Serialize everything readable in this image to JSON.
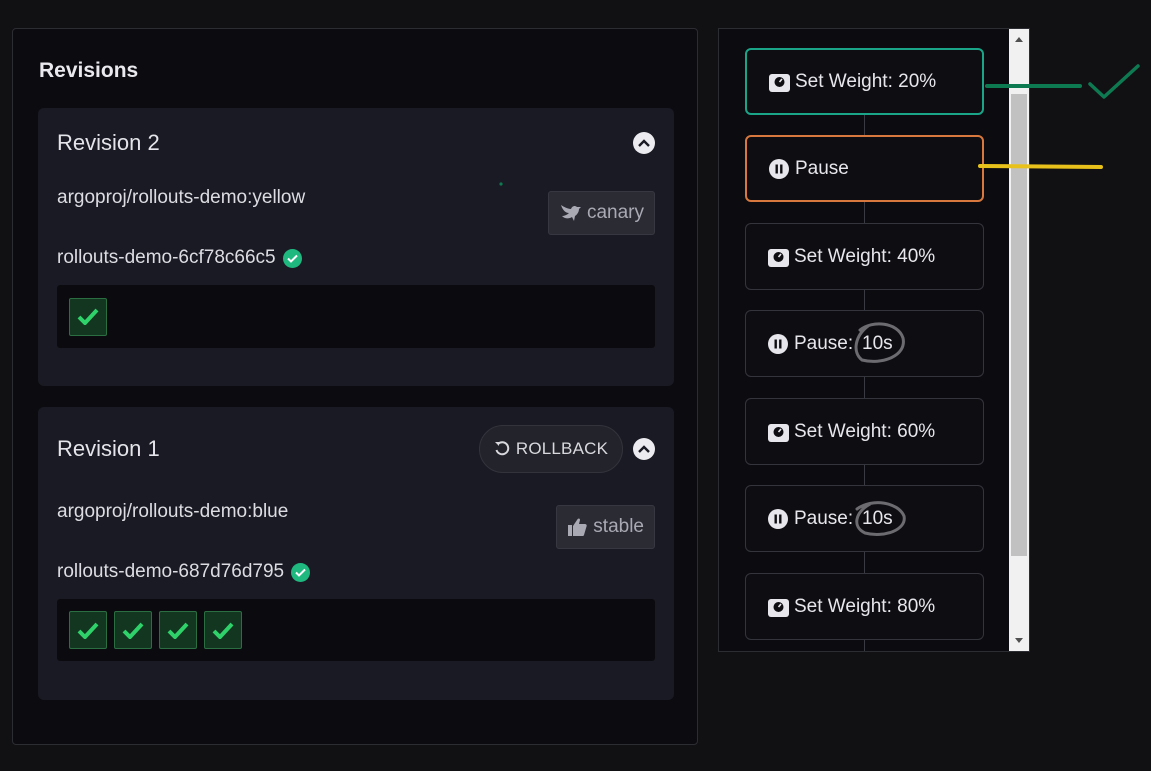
{
  "revisions_panel": {
    "title": "Revisions",
    "revisions": [
      {
        "title": "Revision 2",
        "image": "argoproj/rollouts-demo:yellow",
        "tag": "canary",
        "tag_icon": "dove-icon",
        "replicaset": "rollouts-demo-6cf78c66c5",
        "pods": 1
      },
      {
        "title": "Revision 1",
        "rollback_label": "ROLLBACK",
        "image": "argoproj/rollouts-demo:blue",
        "tag": "stable",
        "tag_icon": "thumbs-up-icon",
        "replicaset": "rollouts-demo-687d76d795",
        "pods": 4
      }
    ]
  },
  "steps_panel": {
    "steps": [
      {
        "label": "Set Weight: 20%",
        "icon": "weight-icon",
        "status": "complete"
      },
      {
        "label": "Pause",
        "icon": "pause-icon",
        "status": "current"
      },
      {
        "label": "Set Weight: 40%",
        "icon": "weight-icon",
        "status": "pending"
      },
      {
        "label": "Pause:",
        "icon": "pause-icon",
        "status": "pending"
      },
      {
        "label": "Set Weight: 60%",
        "icon": "weight-icon",
        "status": "pending"
      },
      {
        "label": "Pause:",
        "icon": "pause-icon",
        "status": "pending"
      },
      {
        "label": "Set Weight: 80%",
        "icon": "weight-icon",
        "status": "pending"
      }
    ],
    "annotations": {
      "pause_duration_1": "10s",
      "pause_duration_2": "10s"
    }
  },
  "colors": {
    "complete": "#1aa488",
    "current": "#d8783e",
    "annotation_green": "#0e7a52",
    "annotation_yellow": "#e8c21a",
    "annotation_gray": "#6b6b70",
    "ok": "#1fb87f"
  }
}
